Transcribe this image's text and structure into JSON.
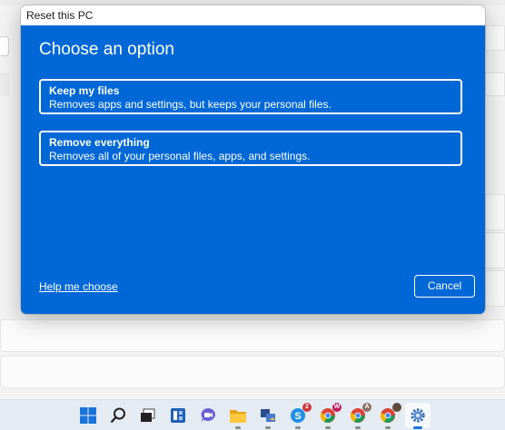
{
  "dialog": {
    "title": "Reset this PC",
    "heading": "Choose an option",
    "options": [
      {
        "title": "Keep my files",
        "description": "Removes apps and settings, but keeps your personal files."
      },
      {
        "title": "Remove everything",
        "description": "Removes all of your personal files, apps, and settings."
      }
    ],
    "help_link": "Help me choose",
    "cancel_label": "Cancel",
    "accent_color": "#0067d6"
  },
  "taskbar": {
    "icons": [
      "windows-start-icon",
      "search-icon",
      "task-view-icon",
      "widgets-icon",
      "chat-icon",
      "file-explorer-icon",
      "app-icon",
      "skype-icon",
      "chrome-profile-w-icon",
      "chrome-profile-a-icon",
      "chrome-profile-icon",
      "settings-icon"
    ],
    "badges": {
      "skype": "2",
      "chrome_w": "W",
      "chrome_a": "A"
    }
  }
}
